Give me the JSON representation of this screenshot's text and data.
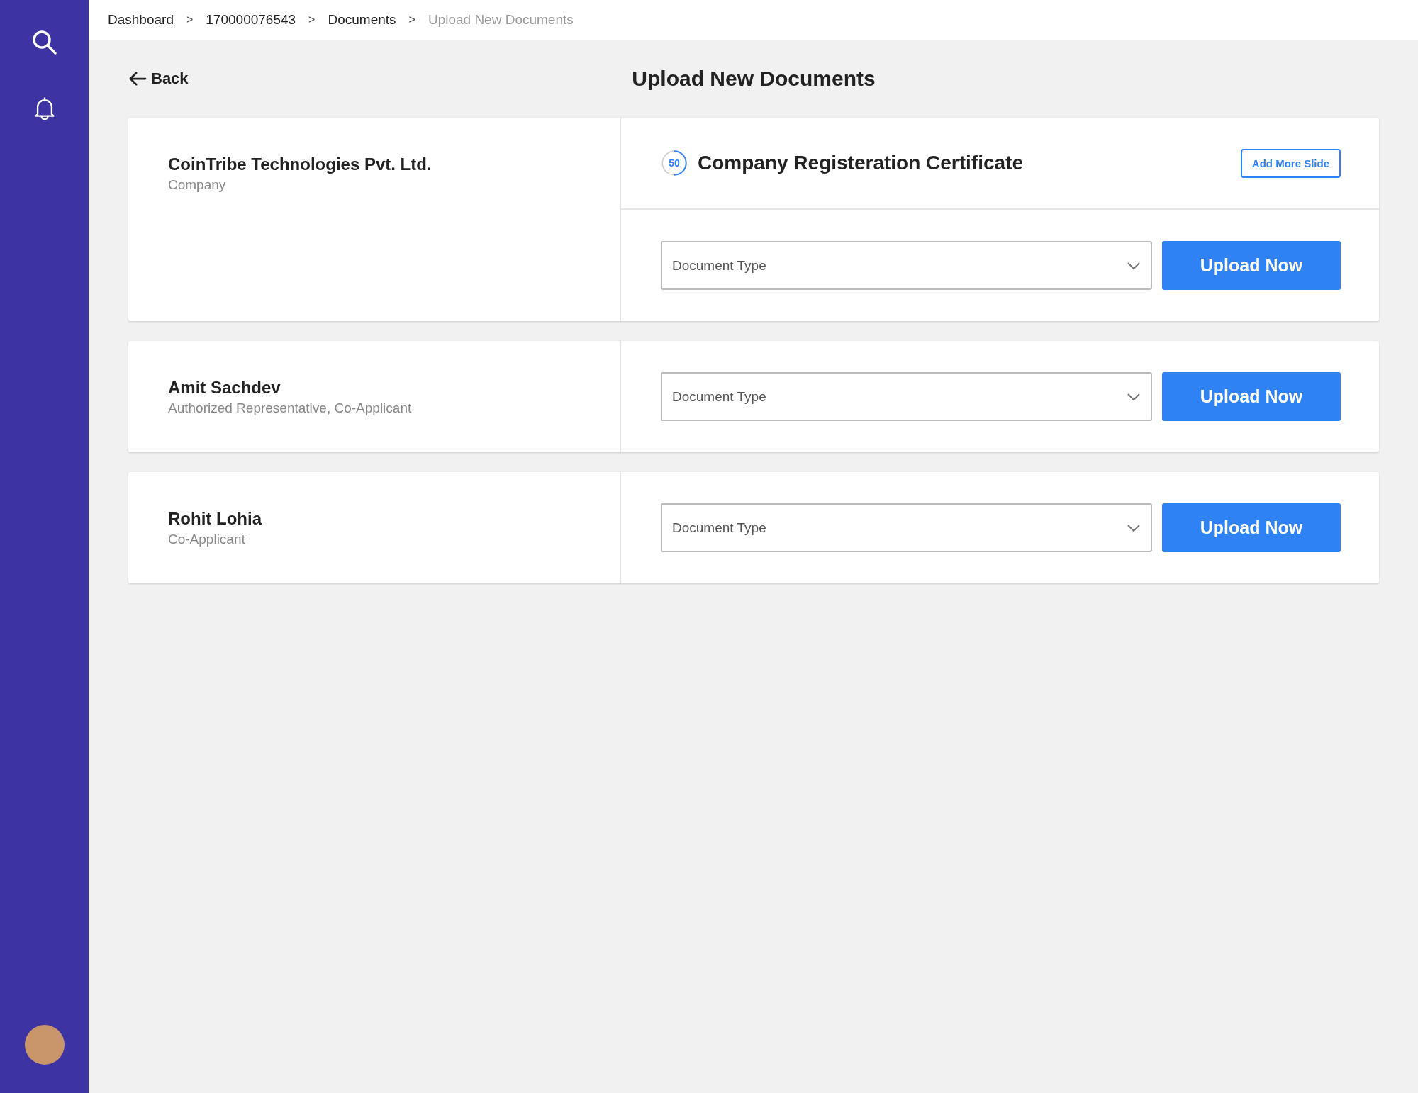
{
  "breadcrumb": [
    {
      "label": "Dashboard",
      "current": false
    },
    {
      "label": "170000076543",
      "current": false
    },
    {
      "label": "Documents",
      "current": false
    },
    {
      "label": "Upload New Documents",
      "current": true
    }
  ],
  "breadcrumb_separator": ">",
  "back": {
    "label": "Back"
  },
  "page_title": "Upload New Documents",
  "applicants": [
    {
      "name": "CoinTribe Technologies Pvt. Ltd.",
      "role": "Company",
      "document": {
        "title": "Company Registeration Certificate",
        "progress_text": "50",
        "level": 0.5,
        "add_button": "Add More Slide"
      },
      "select": {
        "placeholder": "Document Type"
      },
      "upload_button": "Upload Now"
    },
    {
      "name": "Amit Sachdev",
      "role": "Authorized Representative, Co-Applicant",
      "select": {
        "placeholder": "Document Type"
      },
      "upload_button": "Upload Now"
    },
    {
      "name": "Rohit Lohia",
      "role": "Co-Applicant",
      "select": {
        "placeholder": "Document Type"
      },
      "upload_button": "Upload Now"
    }
  ]
}
